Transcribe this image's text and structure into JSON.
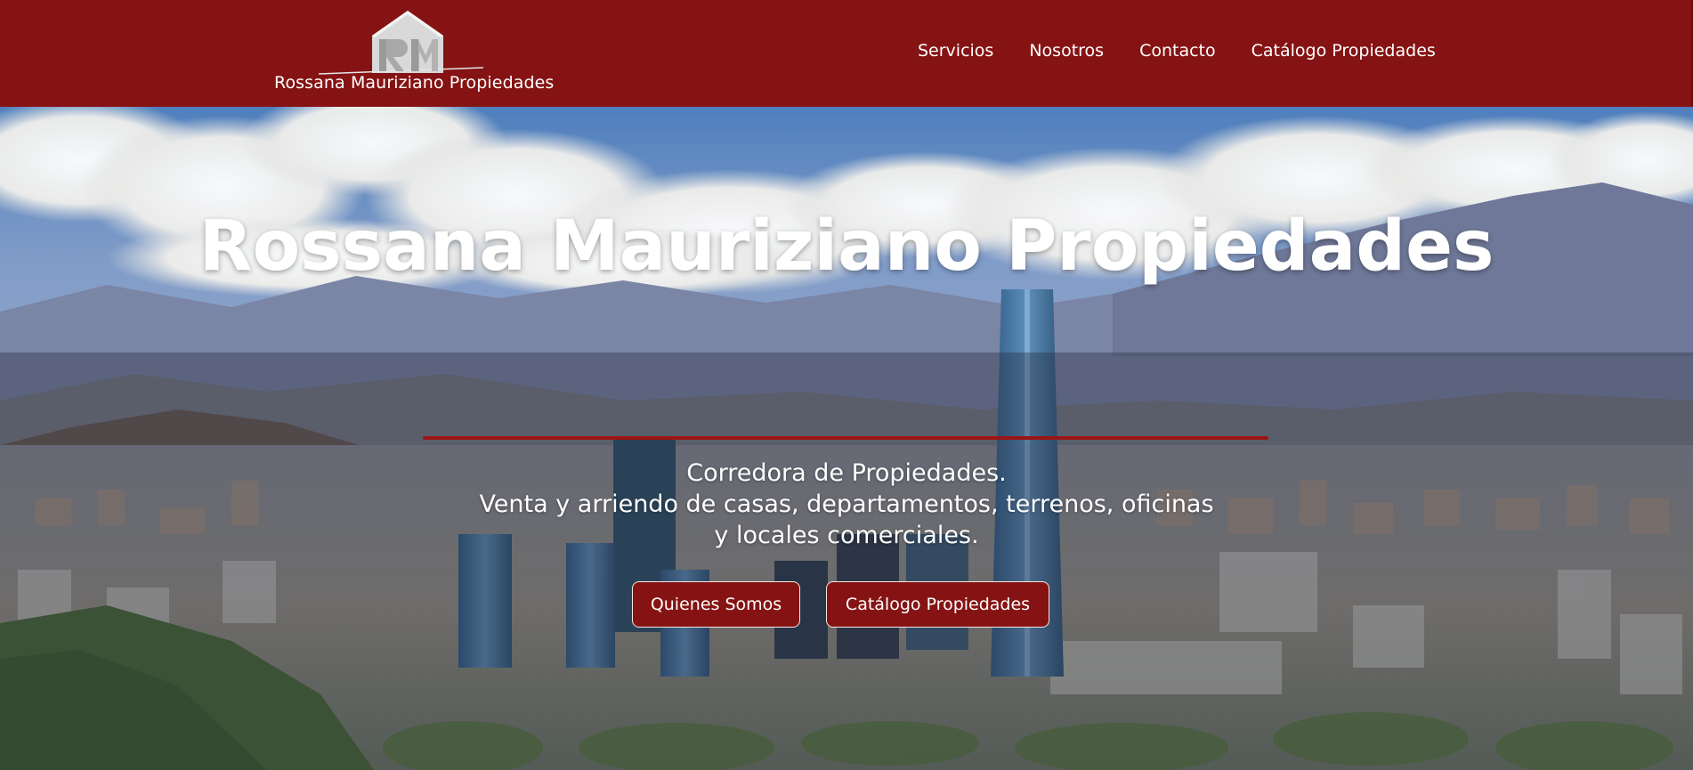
{
  "header": {
    "brand": "Rossana Mauriziano Propiedades",
    "logo_icon": "house-rm-logo-icon",
    "nav": [
      {
        "label": "Servicios"
      },
      {
        "label": "Nosotros"
      },
      {
        "label": "Contacto"
      },
      {
        "label": "Catálogo Propiedades"
      }
    ]
  },
  "hero": {
    "title": "Rossana Mauriziano Propiedades",
    "subtitle": "Corredora de Propiedades.",
    "description": "Venta y arriendo de casas, departamentos, terrenos, oficinas y locales comerciales.",
    "buttons": {
      "about": "Quienes Somos",
      "catalog": "Catálogo Propiedades"
    },
    "background_image": "santiago-city-skyline-photo"
  },
  "colors": {
    "brand": "#861313",
    "text": "#ffffff",
    "accent_rule": "#9b1515"
  }
}
